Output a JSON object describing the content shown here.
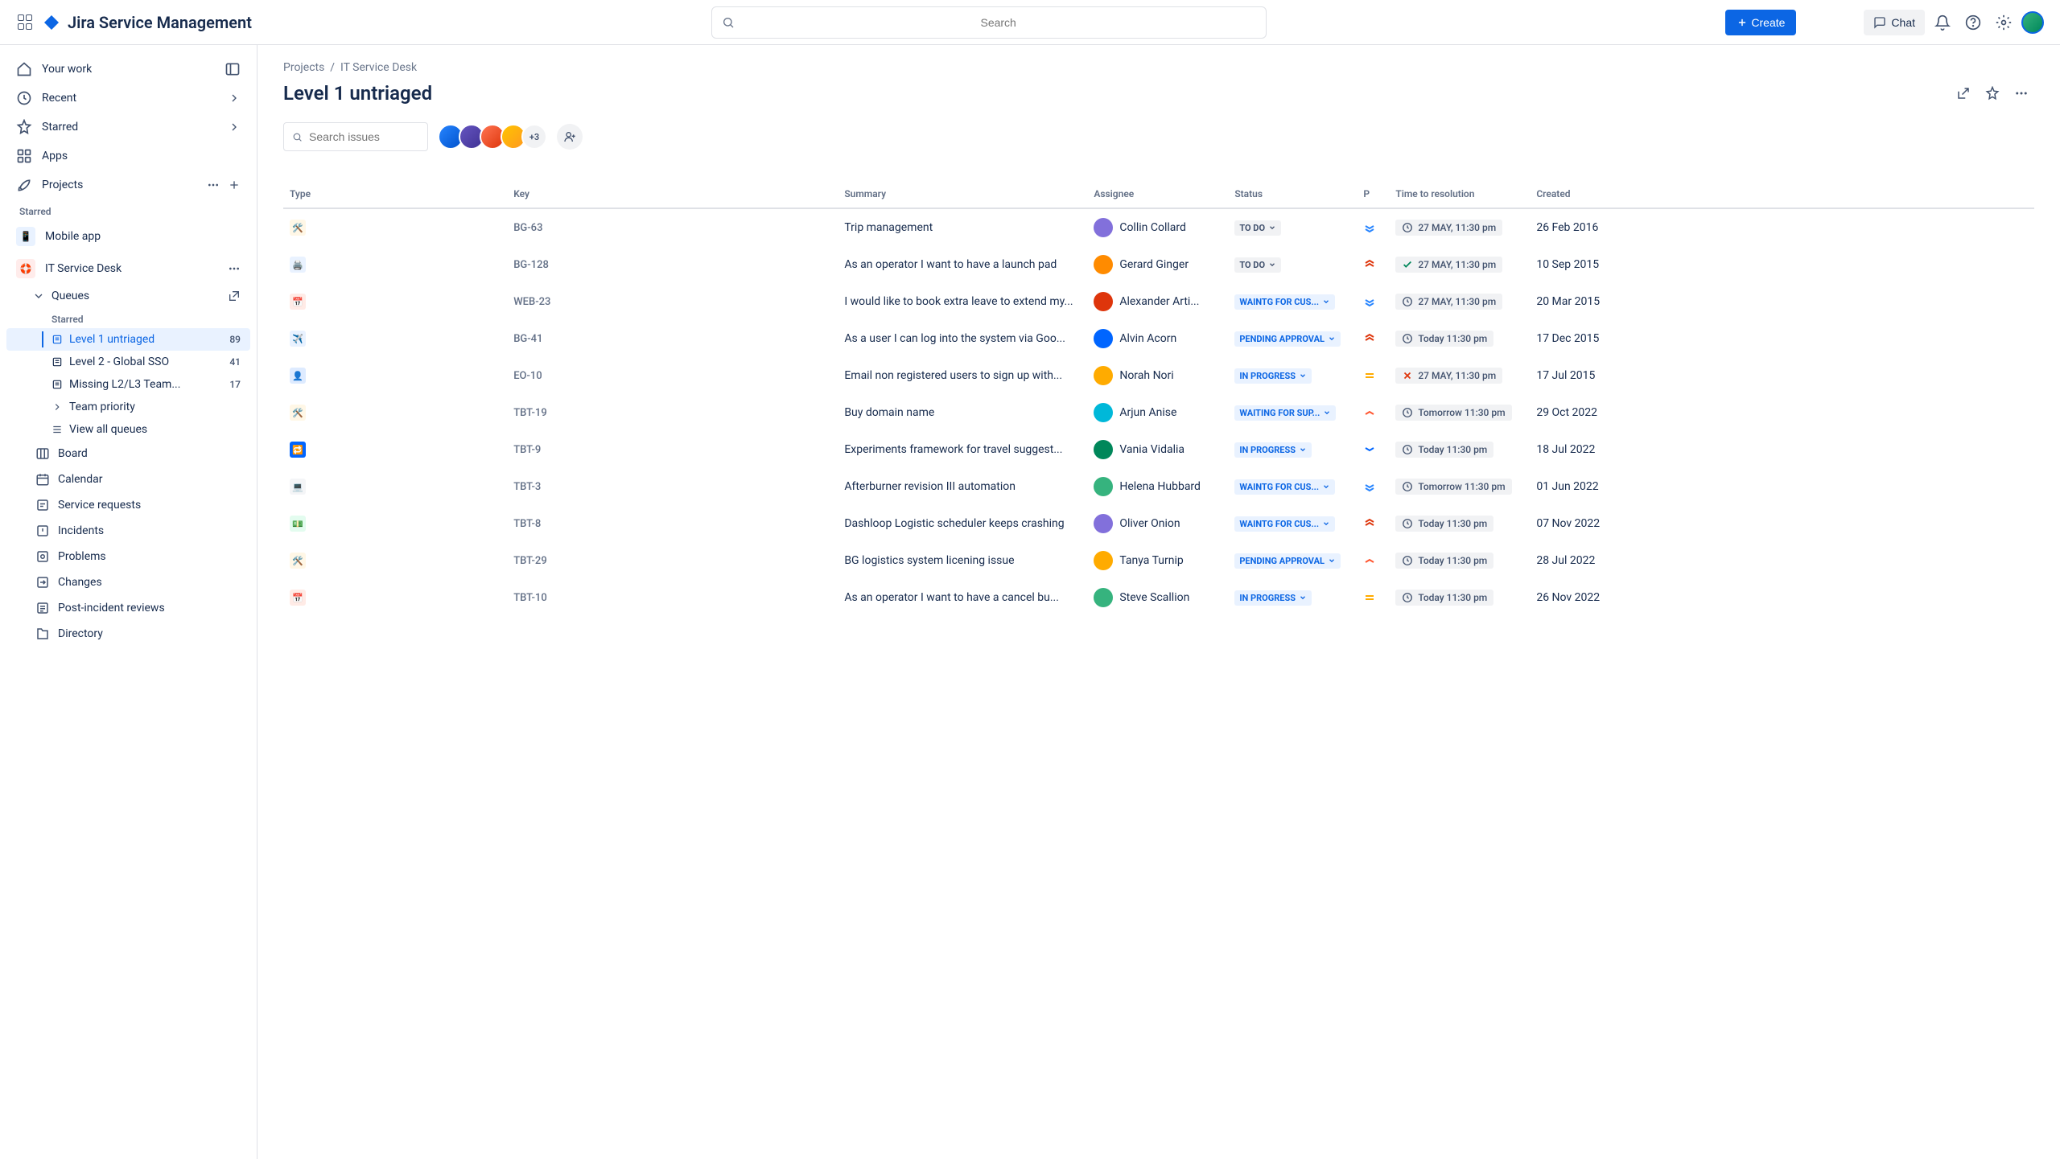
{
  "product_name": "Jira Service Management",
  "search_placeholder": "Search",
  "create_label": "Create",
  "chat_label": "Chat",
  "nav": {
    "your_work": "Your work",
    "recent": "Recent",
    "starred": "Starred",
    "apps": "Apps",
    "projects": "Projects",
    "starred_label": "Starred"
  },
  "projects": {
    "mobile_app": "Mobile app",
    "it_service_desk": "IT Service Desk"
  },
  "tree": {
    "queues": "Queues",
    "starred_label": "Starred",
    "queues_list": [
      {
        "label": "Level 1 untriaged",
        "count": "89",
        "active": true
      },
      {
        "label": "Level 2 - Global SSO",
        "count": "41",
        "active": false
      },
      {
        "label": "Missing L2/L3 Team...",
        "count": "17",
        "active": false
      }
    ],
    "team_priority": "Team priority",
    "view_all_queues": "View all queues",
    "sub_items": [
      "Board",
      "Calendar",
      "Service requests",
      "Incidents",
      "Problems",
      "Changes",
      "Post-incident reviews",
      "Directory"
    ]
  },
  "breadcrumb": {
    "projects": "Projects",
    "project": "IT Service Desk"
  },
  "page_title": "Level 1 untriaged",
  "issue_search_placeholder": "Search issues",
  "avatar_more": "+3",
  "columns": {
    "type": "Type",
    "key": "Key",
    "summary": "Summary",
    "assignee": "Assignee",
    "status": "Status",
    "priority": "P",
    "time": "Time to resolution",
    "created": "Created"
  },
  "rows": [
    {
      "type": "tools",
      "type_bg": "#FFF7E6",
      "key": "BG-63",
      "summary": "Trip management",
      "assignee": "Collin Collard",
      "av": "#8270DB",
      "status": "TO DO",
      "status_class": "status-todo",
      "priority": "lowest",
      "time": "27 MAY, 11:30 pm",
      "time_icon": "clock",
      "created": "26 Feb 2016"
    },
    {
      "type": "printer",
      "type_bg": "#E9F2FF",
      "key": "BG-128",
      "summary": "As an operator I want to have a launch pad",
      "assignee": "Gerard Ginger",
      "av": "#FF8B00",
      "status": "TO DO",
      "status_class": "status-todo",
      "priority": "highest",
      "time": "27 MAY, 11:30 pm",
      "time_icon": "check",
      "created": "10 Sep 2015"
    },
    {
      "type": "calendar",
      "type_bg": "#FFEBE6",
      "key": "WEB-23",
      "summary": "I would like to book extra leave to extend my...",
      "assignee": "Alexander Arti...",
      "av": "#DE350B",
      "status": "WAINTG FOR CUS...",
      "status_class": "status-blue",
      "priority": "lowest",
      "time": "27 MAY, 11:30 pm",
      "time_icon": "clock",
      "created": "20 Mar 2015"
    },
    {
      "type": "plane",
      "type_bg": "#E9F2FF",
      "key": "BG-41",
      "summary": "As a user I can log into the system via Goo...",
      "assignee": "Alvin Acorn",
      "av": "#0065FF",
      "status": "PENDING APPROVAL",
      "status_class": "status-blue",
      "priority": "highest",
      "time": "Today 11:30 pm",
      "time_icon": "clock",
      "created": "17 Dec 2015"
    },
    {
      "type": "person",
      "type_bg": "#DEEBFF",
      "key": "EO-10",
      "summary": "Email non registered users to sign up with...",
      "assignee": "Norah Nori",
      "av": "#FFAB00",
      "status": "IN PROGRESS",
      "status_class": "status-blue",
      "priority": "medium",
      "time": "27 MAY, 11:30 pm",
      "time_icon": "cross",
      "created": "17 Jul 2015"
    },
    {
      "type": "tools",
      "type_bg": "#FFF7E6",
      "key": "TBT-19",
      "summary": "Buy domain name",
      "assignee": "Arjun Anise",
      "av": "#00B8D9",
      "status": "WAITING FOR SUP...",
      "status_class": "status-blue",
      "priority": "high",
      "time": "Tomorrow 11:30 pm",
      "time_icon": "clock",
      "created": "29 Oct 2022"
    },
    {
      "type": "swap",
      "type_bg": "#0065FF",
      "key": "TBT-9",
      "summary": "Experiments framework for travel suggest...",
      "assignee": "Vania Vidalia",
      "av": "#00875A",
      "status": "IN PROGRESS",
      "status_class": "status-blue",
      "priority": "low",
      "time": "Today 11:30 pm",
      "time_icon": "clock",
      "created": "18 Jul 2022"
    },
    {
      "type": "laptop",
      "type_bg": "#F4F5F7",
      "key": "TBT-3",
      "summary": "Afterburner revision III automation",
      "assignee": "Helena Hubbard",
      "av": "#36B37E",
      "status": "WAINTG FOR CUS...",
      "status_class": "status-blue",
      "priority": "lowest",
      "time": "Tomorrow 11:30 pm",
      "time_icon": "clock",
      "created": "01 Jun 2022"
    },
    {
      "type": "money",
      "type_bg": "#E3FCEF",
      "key": "TBT-8",
      "summary": "Dashloop Logistic scheduler keeps crashing",
      "assignee": "Oliver Onion",
      "av": "#8270DB",
      "status": "WAINTG FOR CUS...",
      "status_class": "status-blue",
      "priority": "highest",
      "time": "Today 11:30 pm",
      "time_icon": "clock",
      "created": "07 Nov 2022"
    },
    {
      "type": "tools",
      "type_bg": "#FFF7E6",
      "key": "TBT-29",
      "summary": "BG logistics system licening issue",
      "assignee": "Tanya Turnip",
      "av": "#FFAB00",
      "status": "PENDING APPROVAL",
      "status_class": "status-blue",
      "priority": "high",
      "time": "Today 11:30 pm",
      "time_icon": "clock",
      "created": "28 Jul 2022"
    },
    {
      "type": "calendar",
      "type_bg": "#FFEBE6",
      "key": "TBT-10",
      "summary": "As an operator I want to have a cancel bu...",
      "assignee": "Steve Scallion",
      "av": "#36B37E",
      "status": "IN PROGRESS",
      "status_class": "status-blue",
      "priority": "medium",
      "time": "Today 11:30 pm",
      "time_icon": "clock",
      "created": "26 Nov 2022"
    }
  ]
}
